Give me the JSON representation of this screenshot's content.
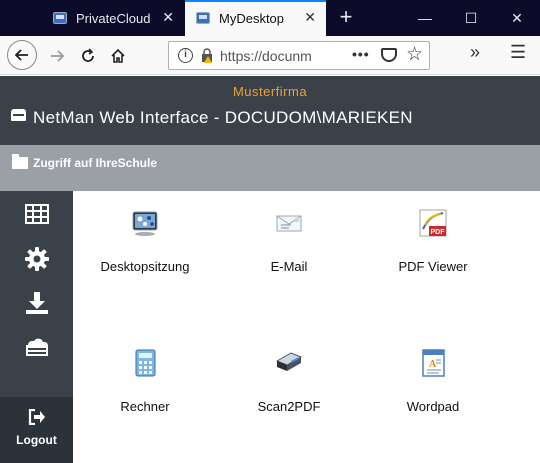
{
  "browser": {
    "tabs": [
      {
        "title": "PrivateCloud",
        "active": false
      },
      {
        "title": "MyDesktop",
        "active": true
      }
    ],
    "url": "https://docunm",
    "icons": {
      "back": "back-arrow-icon",
      "forward": "forward-arrow-icon",
      "reload": "reload-icon",
      "home": "home-icon",
      "info": "info-icon",
      "lock": "lock-warning-icon",
      "page_actions": "more-dots-icon",
      "pocket": "pocket-icon",
      "bookmark": "star-icon",
      "overflow": "chevron-double-right-icon",
      "menu": "hamburger-menu-icon"
    }
  },
  "header": {
    "company": "Musterfirma",
    "title": "NetMan Web Interface - DOCUDOM\\MARIEKEN",
    "accent_color": "#e8a33c",
    "bg_color": "#3a4149"
  },
  "breadcrumb": {
    "label": "Zugriff auf IhreSchule",
    "bg_color": "#9aa0a6"
  },
  "sidebar": {
    "items": [
      {
        "icon": "grid-icon"
      },
      {
        "icon": "gear-icon"
      },
      {
        "icon": "download-icon"
      },
      {
        "icon": "cloud-drive-icon"
      }
    ],
    "logout_label": "Logout"
  },
  "apps": [
    {
      "label": "Desktopsitzung",
      "icon": "remote-desktop-icon"
    },
    {
      "label": "E-Mail",
      "icon": "envelope-icon"
    },
    {
      "label": "PDF Viewer",
      "icon": "pdf-viewer-icon"
    },
    {
      "label": "Rechner",
      "icon": "calculator-icon"
    },
    {
      "label": "Scan2PDF",
      "icon": "scanner-icon"
    },
    {
      "label": "Wordpad",
      "icon": "wordpad-icon"
    }
  ]
}
